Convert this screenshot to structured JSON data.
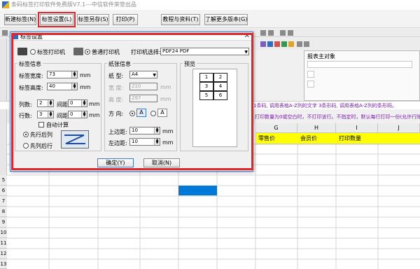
{
  "app": {
    "title": "条码标签打印软件免费版V7.1---中信软件荣誉出品"
  },
  "menu": {
    "new_label": "新建标签(N)",
    "label_settings": "标签设置(L)",
    "save_as": "标签另存(S)",
    "print": "打印(P)",
    "tutorials": "教程与资料(T)",
    "more_versions": "了解更多版本(G)"
  },
  "right_panel": {
    "title": "报表主对象"
  },
  "hints": {
    "line1": "1条码, 调用表格A-Z列的文字 3条形码, 调用表格A-Z列的条形码。",
    "line2": "打印数量为0或空白时，不打印该行。不指定时，默认每行打印一份(允许行除"
  },
  "grid": {
    "columns": [
      "G",
      "H",
      "I",
      "J"
    ],
    "header_cells": [
      "零售价",
      "会员价",
      "打印数量"
    ],
    "rows": [
      "5",
      "6",
      "7",
      "8",
      "9",
      "10",
      "11",
      "12",
      "13"
    ]
  },
  "dialog": {
    "title": "标签设置",
    "close": "✕",
    "radio_label_printer": "标签打印机",
    "radio_normal_printer": "普通打印机",
    "printer_select_label": "打印机选择:",
    "printer_value": "PDF24 PDF",
    "label_info": {
      "title": "标签信息",
      "width_label": "标签宽度:",
      "width_value": "73",
      "height_label": "标签高度:",
      "height_value": "40",
      "unit": "mm",
      "cols_label": "列数:",
      "cols_value": "2",
      "col_gap_label": "间距",
      "col_gap_value": "0",
      "rows_label": "行数:",
      "rows_value": "3",
      "row_gap_label": "间距",
      "row_gap_value": "0",
      "auto_calc": "自动计算",
      "order_col_first": "先行后列",
      "order_row_first": "先列后行"
    },
    "paper_info": {
      "title": "纸张信息",
      "paper_label": "纸  型:",
      "paper_value": "A4",
      "width_label": "宽  度:",
      "width_value": "210",
      "height_label": "高  度:",
      "height_value": "297",
      "unit": "mm",
      "orient_label": "方  向:",
      "orient_a": "A",
      "top_margin_label": "上边距:",
      "top_margin_value": "10",
      "left_margin_label": "左边距:",
      "left_margin_value": "10"
    },
    "preview": {
      "title": "预览",
      "cells": [
        "1",
        "2",
        "3",
        "4",
        "5",
        "6"
      ]
    },
    "ok": "确定(Y)",
    "cancel": "取消(N)"
  },
  "colors": {
    "highlight_red": "#e0262b",
    "selected_cell": "#0078d7",
    "header_yellow": "#ffff00",
    "hint_purple": "#7a1fb0"
  }
}
